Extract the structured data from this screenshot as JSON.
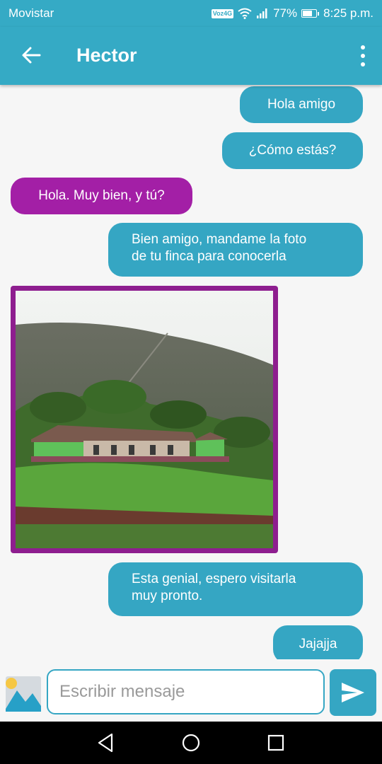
{
  "status_bar": {
    "carrier": "Movistar",
    "volte": "Voz4G",
    "battery": "77%",
    "battery_level": 0.77,
    "time": "8:25 p.m."
  },
  "header": {
    "title": "Hector",
    "back_icon": "arrow-back-icon",
    "menu_icon": "more-vert-icon"
  },
  "messages": [
    {
      "direction": "sent",
      "text": "Hola amigo"
    },
    {
      "direction": "sent",
      "text": "¿Cómo estás?"
    },
    {
      "direction": "received",
      "text": "Hola. Muy bien, y tú?"
    },
    {
      "direction": "sent",
      "text": "Bien amigo, mandame la foto\nde tu finca para conocerla"
    },
    {
      "direction": "received",
      "type": "image",
      "subject": "farmhouse-on-hill"
    },
    {
      "direction": "sent",
      "text": "Esta genial, espero visitarla\nmuy pronto."
    },
    {
      "direction": "sent",
      "text": "Jajajja"
    }
  ],
  "composer": {
    "placeholder": "Escribir mensaje",
    "value": "",
    "gallery_icon": "image-gallery-icon",
    "send_icon": "send-icon"
  },
  "nav_bar": {
    "back_icon": "nav-back-icon",
    "home_icon": "nav-home-icon",
    "recents_icon": "nav-recents-icon"
  },
  "colors": {
    "primary": "#35aac5",
    "sent_bubble": "#35a6c3",
    "received_bubble": "#a31fa6",
    "image_border": "#8e1e8f",
    "background": "#f6f6f6"
  }
}
